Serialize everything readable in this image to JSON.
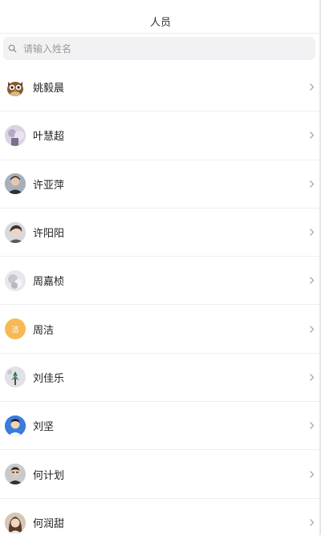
{
  "header": {
    "title": "人员"
  },
  "search": {
    "placeholder": "请输入姓名",
    "value": ""
  },
  "people": [
    {
      "name": "姚毅晨",
      "avatar": "owl-avatar"
    },
    {
      "name": "叶慧超",
      "avatar": "photo-avatar"
    },
    {
      "name": "许亚萍",
      "avatar": "photo-avatar"
    },
    {
      "name": "许阳阳",
      "avatar": "photo-avatar"
    },
    {
      "name": "周嘉桢",
      "avatar": "photo-avatar"
    },
    {
      "name": "周洁",
      "avatar": "initial-avatar",
      "initial": "洁",
      "color": "#f7b955"
    },
    {
      "name": "刘佳乐",
      "avatar": "photo-avatar"
    },
    {
      "name": "刘坚",
      "avatar": "photo-avatar"
    },
    {
      "name": "何计划",
      "avatar": "photo-avatar"
    },
    {
      "name": "何润甜",
      "avatar": "photo-avatar"
    }
  ]
}
